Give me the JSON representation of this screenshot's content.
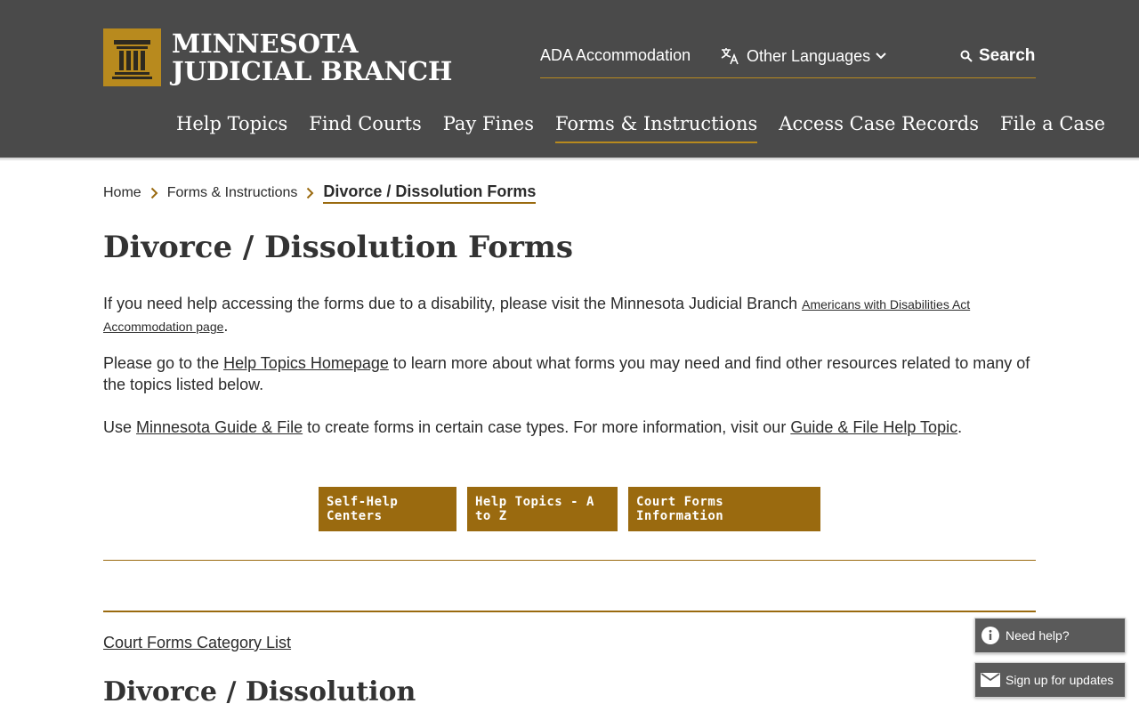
{
  "brand": {
    "line1": "MINNESOTA",
    "line2": "JUDICIAL BRANCH",
    "gold": "#b88a1e",
    "header_bg": "#4a4a4a"
  },
  "utility": {
    "ada": "ADA Accommodation",
    "languages": "Other Languages",
    "search": "Search"
  },
  "nav": [
    {
      "label": "Help Topics"
    },
    {
      "label": "Find Courts"
    },
    {
      "label": "Pay Fines"
    },
    {
      "label": "Forms & Instructions"
    },
    {
      "label": "Access Case Records"
    },
    {
      "label": "File a Case"
    }
  ],
  "breadcrumb": {
    "home": "Home",
    "forms": "Forms & Instructions",
    "current": "Divorce / Dissolution Forms"
  },
  "page": {
    "title": "Divorce / Dissolution Forms",
    "p1_text": "If you need help accessing the forms due to a disability, please visit the Minnesota Judicial Branch ",
    "p1_link": "Americans with Disabilities Act Accommodation page",
    "p1_end": ".",
    "p2_start": "Please go to the ",
    "p2_link": "Help Topics Homepage",
    "p2_end": " to learn more about what forms you may need and find other resources related to many of the topics listed below.",
    "p3_start": "Use ",
    "p3_link1": "Minnesota Guide & File",
    "p3_mid": " to create forms in certain case types. For more information, visit our ",
    "p3_link2": "Guide & File Help Topic",
    "p3_end": "."
  },
  "buttons": {
    "self_help": "Self-Help Centers",
    "help_az": "Help Topics - A to Z",
    "court_forms": "Court Forms Information"
  },
  "category_link": "Court Forms Category List",
  "section_title": "Divorce / Dissolution",
  "floating": {
    "need_help": "Need help?",
    "signup": "Sign up for updates"
  }
}
